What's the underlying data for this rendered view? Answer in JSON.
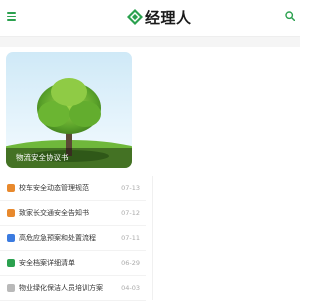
{
  "header": {
    "logo_text": "经理人",
    "menu_icon": "hamburger-menu-icon",
    "search_icon": "search-icon",
    "accent_color": "#2ba14f"
  },
  "featured": {
    "caption": "物流安全协议书",
    "image": "tree-on-grass"
  },
  "articles": [
    {
      "title": "校车安全动态管理规范",
      "date": "07-13",
      "icon_color": "#e8892d"
    },
    {
      "title": "致家长交通安全告知书",
      "date": "07-12",
      "icon_color": "#e8892d"
    },
    {
      "title": "高危应急预案和处置流程",
      "date": "07-11",
      "icon_color": "#3b7be0"
    },
    {
      "title": "安全档案详细清单",
      "date": "06-29",
      "icon_color": "#2ba14f"
    },
    {
      "title": "物业绿化保洁人员培训方案",
      "date": "04-03",
      "icon_color": "#b9b9b9"
    }
  ]
}
